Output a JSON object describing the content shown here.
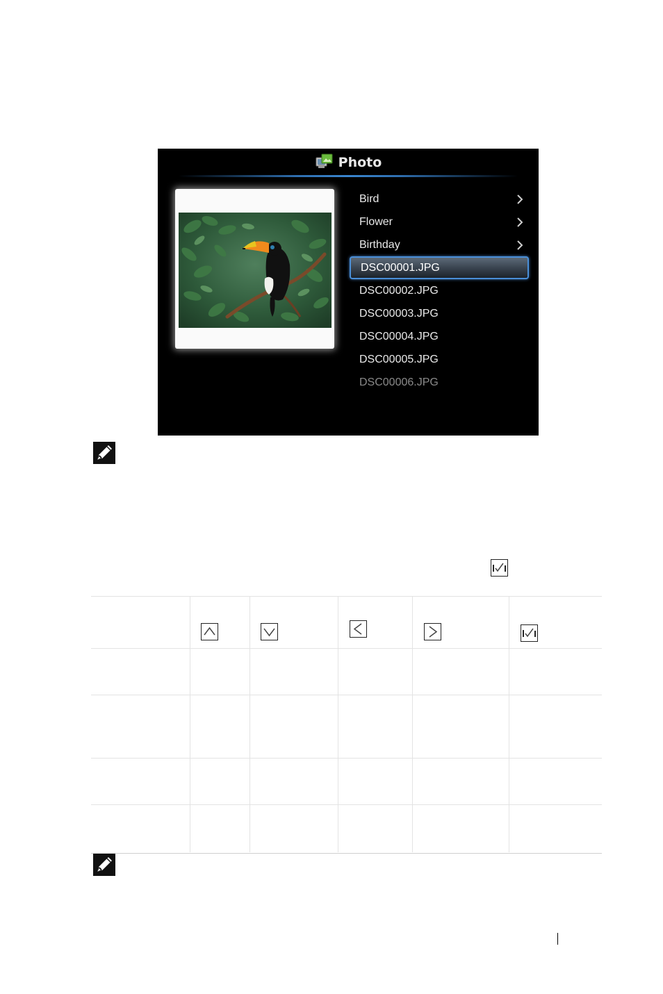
{
  "screen": {
    "title": "Photo",
    "title_icon": "photo-app-icon",
    "preview_image": "toucan-on-branch",
    "items": [
      {
        "label": "Bird",
        "type": "folder"
      },
      {
        "label": "Flower",
        "type": "folder"
      },
      {
        "label": "Birthday",
        "type": "folder"
      },
      {
        "label": "DSC00001.JPG",
        "type": "file",
        "selected": true
      },
      {
        "label": "DSC00002.JPG",
        "type": "file"
      },
      {
        "label": "DSC00003.JPG",
        "type": "file"
      },
      {
        "label": "DSC00004.JPG",
        "type": "file"
      },
      {
        "label": "DSC00005.JPG",
        "type": "file"
      },
      {
        "label": "DSC00006.JPG",
        "type": "file",
        "faded": true
      }
    ]
  },
  "note_icon": "pencil-note-icon",
  "inline_key_icon": "enter-key-icon",
  "table": {
    "header_icons": [
      "up-key-icon",
      "down-key-icon",
      "left-key-icon",
      "right-key-icon",
      "enter-key-icon"
    ],
    "body_rows": 4
  },
  "colors": {
    "screen_bg": "#000000",
    "accent": "#3a86cf",
    "list_text": "#e9e9e9"
  }
}
